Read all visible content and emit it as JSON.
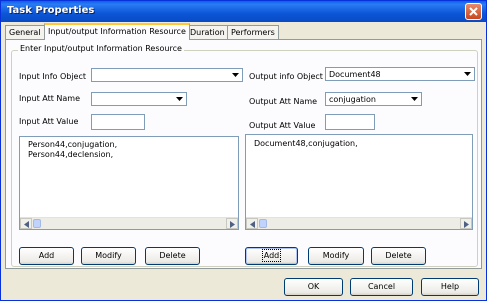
{
  "window": {
    "title": "Task Properties"
  },
  "tabs": [
    "General",
    "Input/output Information Resource",
    "Duration",
    "Performers"
  ],
  "active_tab": "Input/output Information Resource",
  "group": {
    "title": "Enter Input/output Information Resource"
  },
  "input": {
    "info_object_label": "Input Info Object",
    "info_object_value": "",
    "att_name_label": "Input Att Name",
    "att_name_value": "",
    "att_value_label": "Input Att Value",
    "att_value_value": "",
    "list": [
      "Person44,conjugation,",
      "Person44,declension,"
    ],
    "buttons": {
      "add": "Add",
      "modify": "Modify",
      "delete": "Delete"
    }
  },
  "output": {
    "info_object_label": "Output info Object",
    "info_object_value": "Document48",
    "att_name_label": "Output Att Name",
    "att_name_value": "conjugation",
    "att_value_label": "Output Att Value",
    "att_value_value": "",
    "list": [
      "Document48,conjugation,"
    ],
    "buttons": {
      "add": "Add",
      "modify": "Modify",
      "delete": "Delete"
    }
  },
  "footer": {
    "ok": "OK",
    "cancel": "Cancel",
    "help": "Help"
  },
  "colors": {
    "title_bar": "#0A5FEA",
    "dialog_bg": "#ECE9D8",
    "active_tab_accent": "#FFC83C"
  },
  "icons": [
    "close-icon",
    "dropdown-arrow-icon",
    "scroll-left-icon",
    "scroll-right-icon"
  ]
}
